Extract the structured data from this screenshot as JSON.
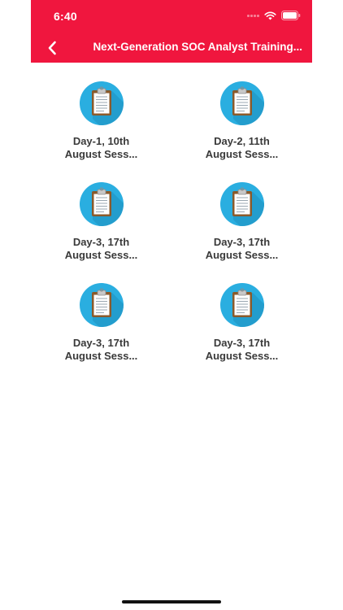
{
  "status_bar": {
    "time": "6:40"
  },
  "header": {
    "title": "Next-Generation SOC Analyst Training...",
    "background": "#f0163e"
  },
  "icon": {
    "name": "clipboard-icon",
    "circle_color": "#2aaee0"
  },
  "sessions": [
    {
      "line1": "Day-1, 10th",
      "line2": "August Sess..."
    },
    {
      "line1": "Day-2, 11th",
      "line2": "August Sess..."
    },
    {
      "line1": "Day-3, 17th",
      "line2": "August Sess..."
    },
    {
      "line1": "Day-3, 17th",
      "line2": "August Sess..."
    },
    {
      "line1": "Day-3, 17th",
      "line2": "August Sess..."
    },
    {
      "line1": "Day-3, 17th",
      "line2": "August Sess..."
    }
  ]
}
